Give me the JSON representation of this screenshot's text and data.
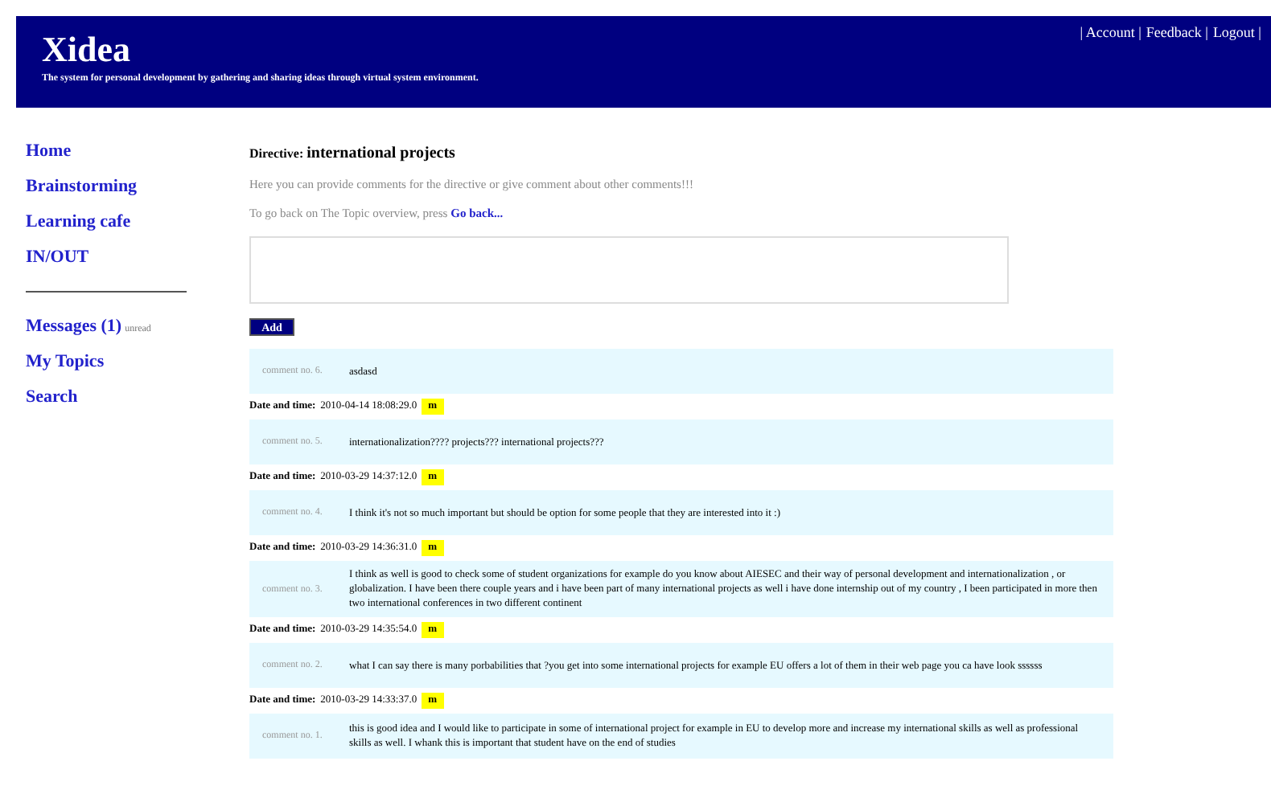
{
  "header": {
    "logo": "Xidea",
    "tagline": "The system for personal development by gathering and sharing ideas through virtual system environment.",
    "links": [
      "| Account |",
      "Feedback |",
      "Logout |"
    ]
  },
  "sidebar": {
    "items": [
      {
        "label": "Home"
      },
      {
        "label": "Brainstorming"
      },
      {
        "label": "Learning cafe"
      },
      {
        "label": "IN/OUT"
      }
    ],
    "items_2": [
      {
        "label": "Messages (1)",
        "note": "unread"
      },
      {
        "label": "My Topics"
      },
      {
        "label": "Search"
      }
    ]
  },
  "directive": {
    "label": "Directive:",
    "title": "international projects"
  },
  "intro": "Here you can provide comments for the directive or give comment about other comments!!!",
  "back": {
    "text": "To go back on The Topic overview, press",
    "link": "Go back..."
  },
  "add_button": "Add",
  "comments": [
    {
      "number": "comment no. 6.",
      "text": "asdasd",
      "date_label": "Date and time:",
      "date": "2010-04-14 18:08:29.0",
      "author": "m"
    },
    {
      "number": "comment no. 5.",
      "text": "internationalization???? projects??? international projects???",
      "date_label": "Date and time:",
      "date": "2010-03-29 14:37:12.0",
      "author": "m"
    },
    {
      "number": "comment no. 4.",
      "text": "I think it's not so much important but should be option for some people that they are interested into it :)",
      "date_label": "Date and time:",
      "date": "2010-03-29 14:36:31.0",
      "author": "m"
    },
    {
      "number": "comment no. 3.",
      "text": "I think as well is good to check some of student organizations for example do you know about AIESEC and their way of personal development and internationalization , or globalization. I have been there couple years and i have been part of many international projects as well i have done internship out of my country , I been participated in more then two international conferences in two different continent",
      "date_label": "Date and time:",
      "date": "2010-03-29 14:35:54.0",
      "author": "m"
    },
    {
      "number": "comment no. 2.",
      "text": "what I can say there is many porbabilities that ?you get into some international projects for example EU offers a lot of them in their web page you ca have look ssssss",
      "date_label": "Date and time:",
      "date": "2010-03-29 14:33:37.0",
      "author": "m"
    },
    {
      "number": "comment no. 1.",
      "text": "this is good idea and I would like to participate in some of international project for example in EU to develop more and increase my international skills as well as professional skills as well. I whank this is important that student have on the end of studies"
    }
  ]
}
